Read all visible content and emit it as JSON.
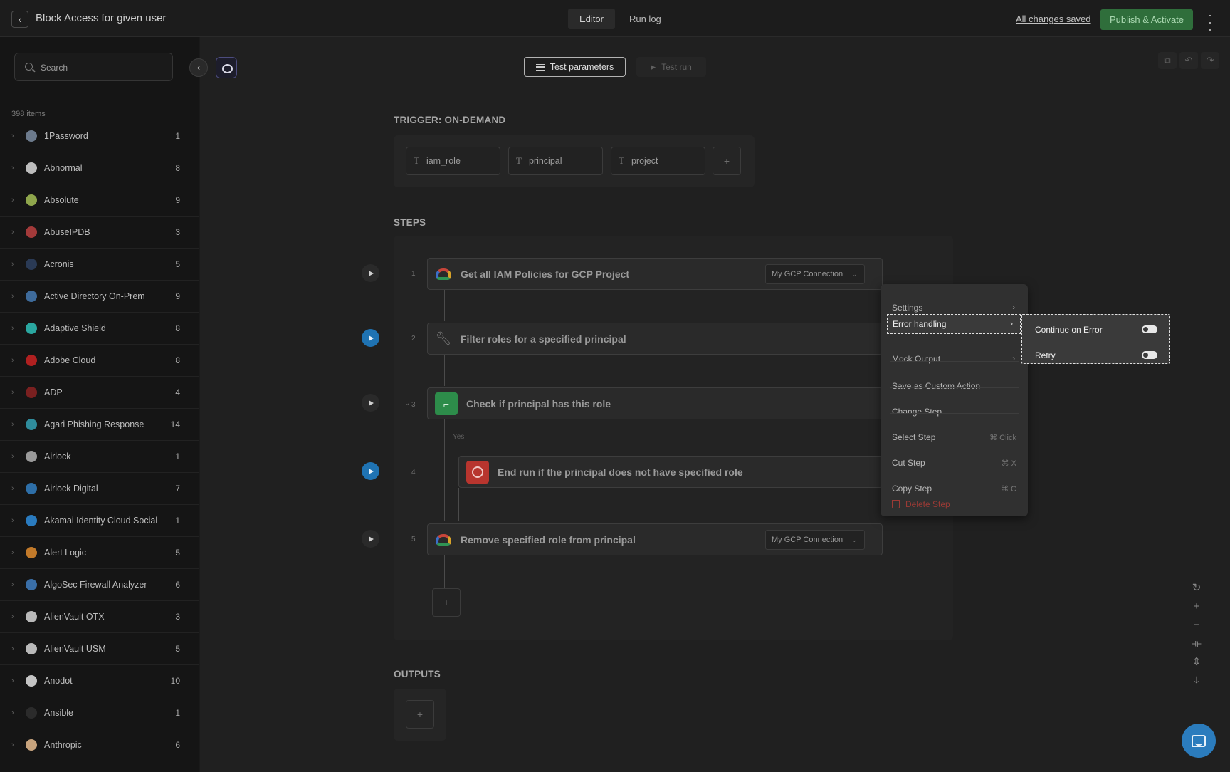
{
  "header": {
    "title": "Block Access for given user",
    "tabs": [
      {
        "label": "Editor",
        "active": true
      },
      {
        "label": "Run log",
        "active": false
      }
    ],
    "saved_status": "All changes saved",
    "publish_label": "Publish & Activate",
    "publish_color": "#2f6e3b"
  },
  "sidebar": {
    "search_placeholder": "Search",
    "item_count": "398 items",
    "items": [
      {
        "name": "1Password",
        "count": "1",
        "icon": "1password-logo",
        "color": "#6c7a8c"
      },
      {
        "name": "Abnormal",
        "count": "8",
        "icon": "abnormal-logo",
        "color": "#bdbdbd"
      },
      {
        "name": "Absolute",
        "count": "9",
        "icon": "absolute-logo",
        "color": "#8fa64c"
      },
      {
        "name": "AbuseIPDB",
        "count": "3",
        "icon": "abuseipdb-logo",
        "color": "#a33a3a"
      },
      {
        "name": "Acronis",
        "count": "5",
        "icon": "acronis-logo",
        "color": "#2a3a55"
      },
      {
        "name": "Active Directory On-Prem",
        "count": "9",
        "icon": "active-directory-logo",
        "color": "#3e6b9b"
      },
      {
        "name": "Adaptive Shield",
        "count": "8",
        "icon": "adaptive-shield-logo",
        "color": "#2aa7a0"
      },
      {
        "name": "Adobe Cloud",
        "count": "8",
        "icon": "adobe-logo",
        "color": "#b02020"
      },
      {
        "name": "ADP",
        "count": "4",
        "icon": "adp-logo",
        "color": "#7a2020"
      },
      {
        "name": "Agari Phishing Response",
        "count": "14",
        "icon": "agari-logo",
        "color": "#2f8c9c"
      },
      {
        "name": "Airlock",
        "count": "1",
        "icon": "airlock-logo",
        "color": "#9a9a9a"
      },
      {
        "name": "Airlock Digital",
        "count": "7",
        "icon": "airlock-digital-logo",
        "color": "#2e6fa8"
      },
      {
        "name": "Akamai Identity Cloud Social",
        "count": "1",
        "icon": "akamai-logo",
        "color": "#2a7bbf"
      },
      {
        "name": "Alert Logic",
        "count": "5",
        "icon": "alert-logic-logo",
        "color": "#c27a2a"
      },
      {
        "name": "AlgoSec Firewall Analyzer",
        "count": "6",
        "icon": "algosec-logo",
        "color": "#3a6fa8"
      },
      {
        "name": "AlienVault OTX",
        "count": "3",
        "icon": "alienvault-logo",
        "color": "#b9b9b9"
      },
      {
        "name": "AlienVault USM",
        "count": "5",
        "icon": "alienvault-logo",
        "color": "#b9b9b9"
      },
      {
        "name": "Anodot",
        "count": "10",
        "icon": "anodot-logo",
        "color": "#c4c4c4"
      },
      {
        "name": "Ansible",
        "count": "1",
        "icon": "ansible-logo",
        "color": "#2b2b2b"
      },
      {
        "name": "Anthropic",
        "count": "6",
        "icon": "anthropic-logo",
        "color": "#c8a47e"
      }
    ]
  },
  "toolbar": {
    "test_parameters_label": "Test parameters",
    "test_run_label": "Test run"
  },
  "trigger": {
    "label": "TRIGGER: ON-DEMAND",
    "params": [
      "iam_role",
      "principal",
      "project"
    ]
  },
  "steps": {
    "label": "STEPS",
    "items": [
      {
        "num": "1",
        "title": "Get all IAM Policies for GCP Project",
        "icon": "gcp-icon",
        "connection": "My GCP Connection"
      },
      {
        "num": "2",
        "title": "Filter roles for a specified principal",
        "icon": "wrench-icon"
      },
      {
        "num": "3",
        "title": "Check if principal has this role",
        "icon": "branch-icon",
        "branch_label": "Yes"
      },
      {
        "num": "4",
        "title": "End run if the principal does not have specified role",
        "icon": "stop-icon"
      },
      {
        "num": "5",
        "title": "Remove specified role from principal",
        "icon": "gcp-icon",
        "connection": "My GCP Connection"
      }
    ]
  },
  "outputs": {
    "label": "OUTPUTS"
  },
  "context_menu": {
    "items": [
      {
        "label": "Settings",
        "has_submenu": true
      },
      {
        "label": "Error handling",
        "has_submenu": true,
        "highlighted": true
      },
      {
        "label": "Mock Output",
        "has_submenu": true
      },
      {
        "label": "Save as Custom Action"
      },
      {
        "label": "Change Step"
      },
      {
        "label": "Select Step",
        "shortcut": "⌘ Click"
      },
      {
        "label": "Cut Step",
        "shortcut": "⌘ X"
      },
      {
        "label": "Copy Step",
        "shortcut": "⌘ C"
      },
      {
        "label": "Delete Step",
        "danger": true
      }
    ]
  },
  "submenu": {
    "items": [
      {
        "label": "Continue on Error",
        "enabled": false
      },
      {
        "label": "Retry",
        "enabled": false
      }
    ]
  }
}
